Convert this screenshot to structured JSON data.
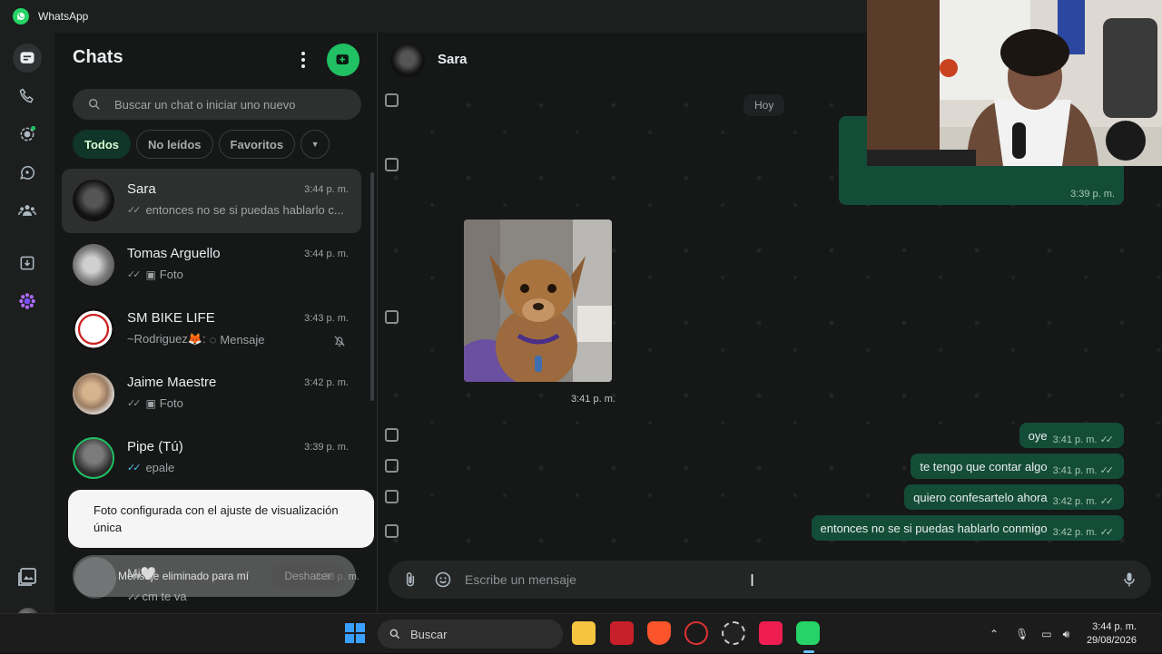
{
  "app": {
    "title": "WhatsApp"
  },
  "sidebar": {
    "title": "Chats",
    "search_placeholder": "Buscar un chat o iniciar uno nuevo",
    "filters": [
      "Todos",
      "No leídos",
      "Favoritos"
    ],
    "chats": [
      {
        "name": "Sara",
        "time": "3:44 p. m.",
        "preview": "entonces no se si puedas hablarlo c...",
        "tick": "read",
        "selected": true
      },
      {
        "name": "Tomas Arguello",
        "time": "3:44 p. m.",
        "preview": "Foto",
        "tick": "sent",
        "photo": true
      },
      {
        "name": "SM BIKE LIFE",
        "time": "3:43 p. m.",
        "preview_sender": "~Rodriguez🦊:",
        "preview": "Mensaje",
        "muted": true
      },
      {
        "name": "Jaime Maestre",
        "time": "3:42 p. m.",
        "preview": "Foto",
        "tick": "sent",
        "photo": true
      },
      {
        "name": "Pipe (Tú)",
        "time": "3:39 p. m.",
        "preview": "epale",
        "tick": "read"
      }
    ],
    "partial_chat": {
      "name": "Mi",
      "name_suffix": "🤍",
      "time": "3:38 p. m.",
      "preview": "cm te va"
    }
  },
  "toast": {
    "message": "Foto configurada con el ajuste de visualización única",
    "deleted_message": "Mensaje eliminado para mí",
    "undo_label": "Deshacer"
  },
  "conversation": {
    "contact_name": "Sara",
    "day_label": "Hoy",
    "outgoing_card_time": "3:39 p. m.",
    "photo_time": "3:41 p. m.",
    "messages": [
      {
        "text": "oye",
        "time": "3:41 p. m."
      },
      {
        "text": "te tengo que contar algo",
        "time": "3:41 p. m."
      },
      {
        "text": "quiero confesartelo ahora",
        "time": "3:42 p. m."
      },
      {
        "text": "entonces no se si puedas hablarlo conmigo",
        "time": "3:42 p. m."
      }
    ],
    "composer_placeholder": "Escribe un mensaje"
  },
  "taskbar": {
    "search_label": "Buscar",
    "time": "3:44 p. m.",
    "date": "29/08/2026"
  },
  "colors": {
    "accent": "#21c063",
    "outgoing_bubble": "#144d37",
    "read_tick": "#53bdeb"
  }
}
